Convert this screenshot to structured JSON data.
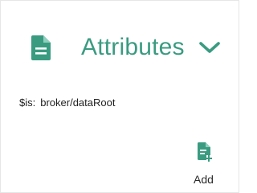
{
  "panel": {
    "title": "Attributes",
    "title_icon": "document-icon",
    "toggle_icon": "chevron-down-icon",
    "accent_color": "#3a9b80"
  },
  "meta": {
    "key": "$is:",
    "value": "broker/dataRoot"
  },
  "actions": {
    "add": {
      "label": "Add",
      "icon": "add-document-icon"
    }
  }
}
